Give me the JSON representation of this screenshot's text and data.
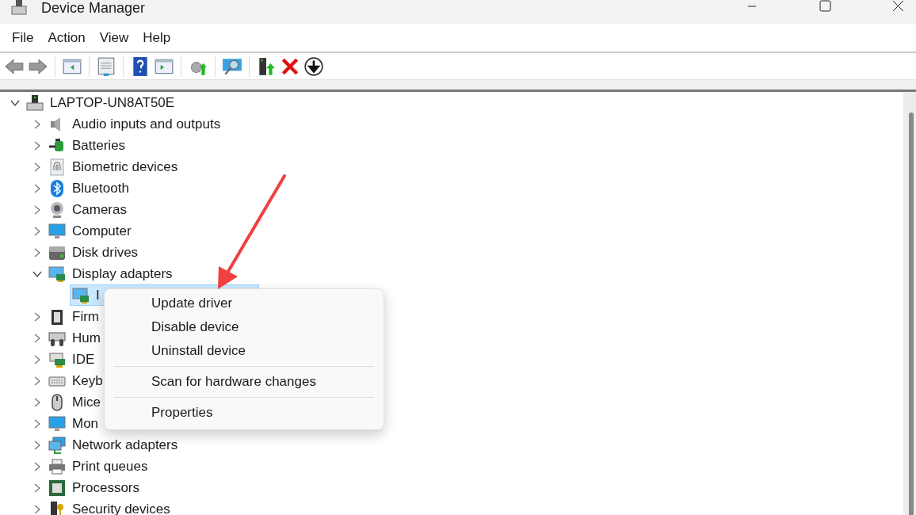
{
  "window": {
    "title": "Device Manager"
  },
  "menu_bar": [
    "File",
    "Action",
    "View",
    "Help"
  ],
  "tree": {
    "label": "LAPTOP-UN8AT50E",
    "expanded": true,
    "selected": false,
    "children": [
      {
        "label": "Audio inputs and outputs",
        "expanded": false,
        "selected": false
      },
      {
        "label": "Batteries",
        "expanded": false,
        "selected": false
      },
      {
        "label": "Biometric devices",
        "expanded": false,
        "selected": false
      },
      {
        "label": "Bluetooth",
        "expanded": false,
        "selected": false
      },
      {
        "label": "Cameras",
        "expanded": false,
        "selected": false
      },
      {
        "label": "Computer",
        "expanded": false,
        "selected": false
      },
      {
        "label": "Disk drives",
        "expanded": false,
        "selected": false
      },
      {
        "label": "Display adapters",
        "expanded": true,
        "selected": false,
        "children": [
          {
            "label": "I",
            "selected": true
          }
        ]
      },
      {
        "label": "Firm",
        "expanded": false,
        "selected": false
      },
      {
        "label": "Hum",
        "expanded": false,
        "selected": false
      },
      {
        "label": "IDE",
        "expanded": false,
        "selected": false
      },
      {
        "label": "Keyb",
        "expanded": false,
        "selected": false
      },
      {
        "label": "Mice",
        "expanded": false,
        "selected": false
      },
      {
        "label": "Mon",
        "expanded": false,
        "selected": false
      },
      {
        "label": "Network adapters",
        "expanded": false,
        "selected": false
      },
      {
        "label": "Print queues",
        "expanded": false,
        "selected": false
      },
      {
        "label": "Processors",
        "expanded": false,
        "selected": false
      },
      {
        "label": "Security devices",
        "expanded": false,
        "selected": false
      }
    ]
  },
  "context_menu": [
    {
      "kind": "item",
      "label": "Update driver"
    },
    {
      "kind": "item",
      "label": "Disable device"
    },
    {
      "kind": "item",
      "label": "Uninstall device"
    },
    {
      "kind": "separator"
    },
    {
      "kind": "item",
      "label": "Scan for hardware changes"
    },
    {
      "kind": "separator"
    },
    {
      "kind": "item",
      "label": "Properties"
    }
  ]
}
